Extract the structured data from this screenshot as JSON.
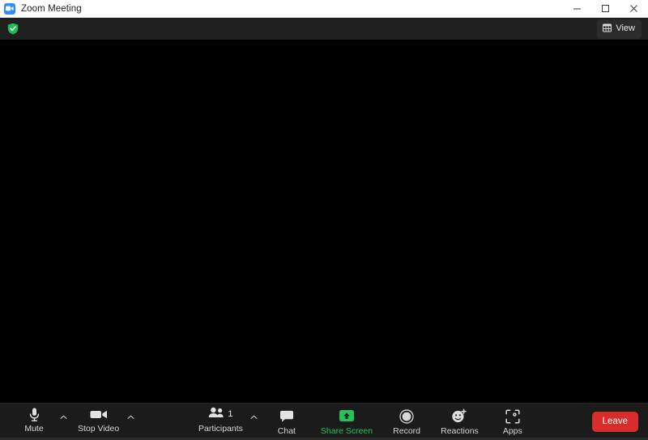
{
  "window": {
    "title": "Zoom Meeting",
    "logo_icon": "zoom-camera-logo",
    "controls": {
      "minimize": "minimize-icon",
      "maximize": "maximize-icon",
      "close": "close-icon"
    }
  },
  "topbar": {
    "encryption_badge": {
      "icon": "green-shield-check-icon",
      "color": "#21b857"
    },
    "view_button": {
      "label": "View",
      "icon": "layout-grid-icon"
    }
  },
  "stage": {
    "background_color": "#000000"
  },
  "toolbar": {
    "background_color": "#1b1b1b",
    "accent_color": "#22c35e",
    "leave_color": "#d92d2d",
    "items": [
      {
        "label": "Mute",
        "icon": "microphone-icon",
        "has_caret": true,
        "caret_name": "audio-options-caret"
      },
      {
        "label": "Stop Video",
        "icon": "video-camera-icon",
        "has_caret": true,
        "caret_name": "video-options-caret"
      },
      {
        "label": "Participants",
        "icon": "participants-icon",
        "badge": "1",
        "has_caret": true,
        "caret_name": "participants-options-caret"
      },
      {
        "label": "Chat",
        "icon": "chat-bubble-icon",
        "has_caret": false
      },
      {
        "label": "Share Screen",
        "icon": "share-screen-up-arrow-icon",
        "has_caret": false,
        "accent": true
      },
      {
        "label": "Record",
        "icon": "record-circle-icon",
        "has_caret": false
      },
      {
        "label": "Reactions",
        "icon": "smiley-plus-icon",
        "has_caret": false
      },
      {
        "label": "Apps",
        "icon": "apps-frame-icon",
        "has_caret": false
      }
    ],
    "leave_label": "Leave"
  }
}
